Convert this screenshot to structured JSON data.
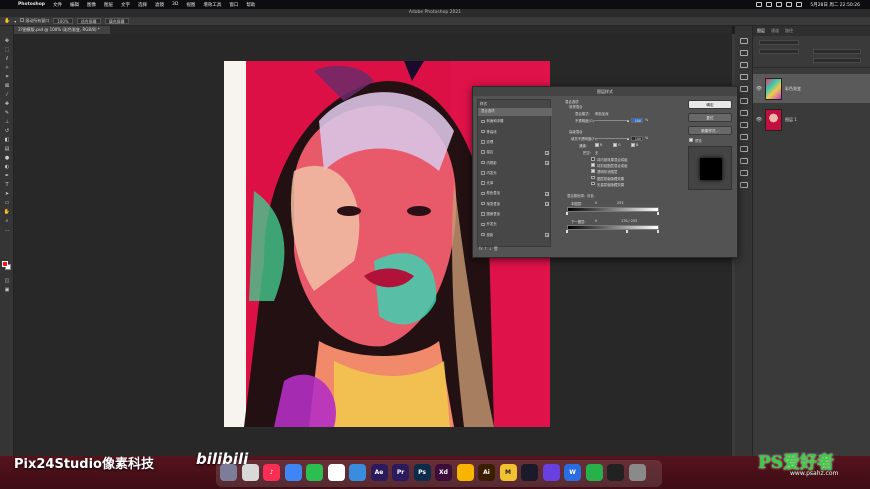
{
  "menubar": {
    "app_name": "Photoshop",
    "items": [
      "文件",
      "编辑",
      "图像",
      "图层",
      "文字",
      "选择",
      "滤镜",
      "3D",
      "视图",
      "增效工具",
      "窗口",
      "帮助"
    ],
    "clock": "5月28日 周二 22:50:26"
  },
  "window_title": "Adobe Photoshop 2021",
  "options_bar": {
    "scroll_all_windows": "滚动所有窗口",
    "zoom": "100%",
    "fit_screen": "适合屏幕",
    "fill_screen": "填充屏幕"
  },
  "document_tab": "3?图模版.psd @ 100% (彩色渐变, RGB/8) *",
  "layers_panel": {
    "tabs": [
      "图层",
      "通道",
      "路径"
    ],
    "layers": [
      {
        "name": "彩色渐变",
        "selected": true
      },
      {
        "name": "图层 1",
        "selected": false
      }
    ]
  },
  "dialog": {
    "title": "图层样式",
    "styles_header": "样式",
    "styles": [
      {
        "label": "混合选项",
        "selected": true,
        "checkbox": false,
        "plus": false
      },
      {
        "label": "斜面和浮雕",
        "selected": false,
        "checkbox": true,
        "plus": false
      },
      {
        "label": "等高线",
        "selected": false,
        "checkbox": true,
        "plus": false
      },
      {
        "label": "纹理",
        "selected": false,
        "checkbox": true,
        "plus": false
      },
      {
        "label": "描边",
        "selected": false,
        "checkbox": true,
        "plus": true
      },
      {
        "label": "内阴影",
        "selected": false,
        "checkbox": true,
        "plus": true
      },
      {
        "label": "内发光",
        "selected": false,
        "checkbox": true,
        "plus": false
      },
      {
        "label": "光泽",
        "selected": false,
        "checkbox": true,
        "plus": false
      },
      {
        "label": "颜色叠加",
        "selected": false,
        "checkbox": true,
        "plus": true
      },
      {
        "label": "渐变叠加",
        "selected": false,
        "checkbox": true,
        "plus": true
      },
      {
        "label": "图案叠加",
        "selected": false,
        "checkbox": true,
        "plus": false
      },
      {
        "label": "外发光",
        "selected": false,
        "checkbox": true,
        "plus": false
      },
      {
        "label": "投影",
        "selected": false,
        "checkbox": true,
        "plus": true
      }
    ],
    "footer": "fx  ↑  ↓       🗑",
    "blend_options": {
      "section": "混合选项",
      "general": "常规混合",
      "mode_label": "混合模式:",
      "mode_value": "明色加深",
      "opacity_label": "不透明度(O):",
      "opacity_value": "100",
      "pct": "%",
      "advanced": "高级混合",
      "fill_label": "填充不透明度(F):",
      "fill_value": "100",
      "channels_label": "通道:",
      "channels": [
        "R",
        "G",
        "B"
      ],
      "knockout_label": "挖空:",
      "knockout_value": "无",
      "options": [
        {
          "label": "将内部效果混合成组",
          "checked": false
        },
        {
          "label": "将剪贴图层混合成组",
          "checked": true
        },
        {
          "label": "透明形状图层",
          "checked": true
        },
        {
          "label": "图层蒙版隐藏效果",
          "checked": false
        },
        {
          "label": "矢量蒙版隐藏效果",
          "checked": false
        }
      ],
      "blend_if_label": "混合颜色带:",
      "blend_if_value": "灰色",
      "this_layer_label": "本图层:",
      "this_layer_min": "0",
      "this_layer_max": "255",
      "under_layer_label": "下一图层:",
      "under_layer_min": "0",
      "under_layer_mid": "176 / 255"
    },
    "buttons": {
      "ok": "确定",
      "reset": "复位",
      "new_style": "新建样式...",
      "preview": "预览"
    }
  },
  "watermark_left": "Pix24Studio像素科技",
  "bilibili": "bilibili",
  "dock_icons": [
    {
      "label": "",
      "color": "#7d7d9a"
    },
    {
      "label": "",
      "color": "#d9d9d9"
    },
    {
      "label": "♪",
      "color": "#fa2d55"
    },
    {
      "label": "",
      "color": "#3f86f4"
    },
    {
      "label": "",
      "color": "#2bbf4f"
    },
    {
      "label": "",
      "color": "#ffffff"
    },
    {
      "label": "",
      "color": "#3a8dde"
    },
    {
      "label": "Ae",
      "color": "#2b1a5e"
    },
    {
      "label": "Pr",
      "color": "#2b1a5e"
    },
    {
      "label": "Ps",
      "color": "#0d2b4a"
    },
    {
      "label": "Xd",
      "color": "#3c0d3a"
    },
    {
      "label": "",
      "color": "#f7b500"
    },
    {
      "label": "Ai",
      "color": "#3b1d00"
    },
    {
      "label": "M",
      "color": "#f2c230"
    },
    {
      "label": "",
      "color": "#1a1a2a"
    },
    {
      "label": "",
      "color": "#6a3fe0"
    },
    {
      "label": "W",
      "color": "#2a6de0"
    },
    {
      "label": "",
      "color": "#26b14a"
    },
    {
      "label": "",
      "color": "#222222"
    },
    {
      "label": "",
      "color": "#8a8a8a"
    }
  ],
  "watermark_right": "PS爱好者",
  "watermark_url": "www.psahz.com"
}
